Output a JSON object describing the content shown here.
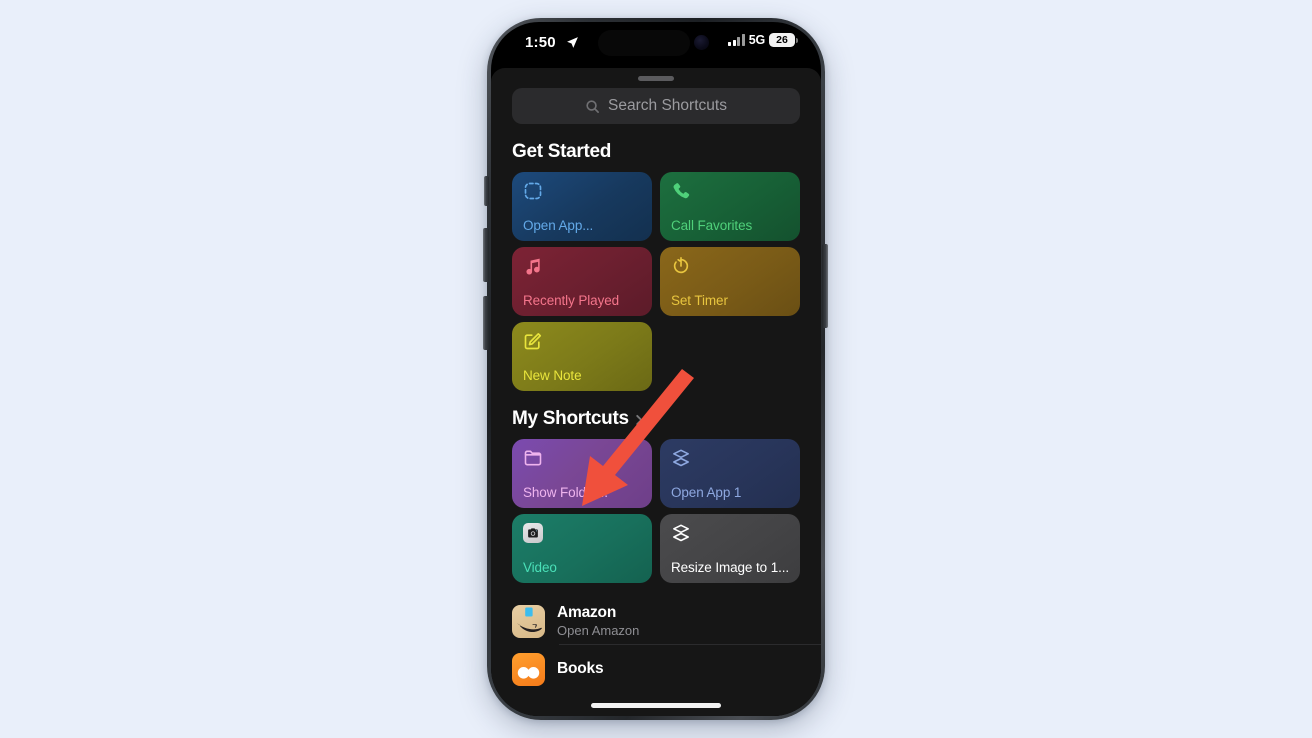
{
  "colors": {
    "page_background": "#e9effa",
    "screen_background": "#000000",
    "sheet_background": "#161616",
    "accent_arrow": "#f0503c",
    "search_field": "#2b2b2d"
  },
  "status_bar": {
    "time": "1:50",
    "location_icon": "location-arrow-icon",
    "cellular_icon": "cellular-bars-icon",
    "network": "5G",
    "battery_level": "26",
    "battery_icon": "battery-icon"
  },
  "sheet": {
    "grabber": "sheet-grabber"
  },
  "search": {
    "icon": "search-icon",
    "placeholder": "Search Shortcuts",
    "value": ""
  },
  "sections": [
    {
      "title": "Get Started",
      "has_chevron": false,
      "tiles": [
        {
          "label": "Open App...",
          "icon": "dashed-square-icon",
          "theme": "t-blue",
          "text_color": "#63a9e8",
          "icon_color": "#63a9e8"
        },
        {
          "label": "Call Favorites",
          "icon": "phone-icon",
          "theme": "t-green",
          "text_color": "#4fd07a",
          "icon_color": "#4fd07a"
        },
        {
          "label": "Recently Played",
          "icon": "music-note-icon",
          "theme": "t-red",
          "text_color": "#f4758b",
          "icon_color": "#f4758b"
        },
        {
          "label": "Set Timer",
          "icon": "timer-icon",
          "theme": "t-orange",
          "text_color": "#e8c53f",
          "icon_color": "#e8c53f"
        },
        {
          "label": "New Note",
          "icon": "compose-note-icon",
          "theme": "t-yellow",
          "text_color": "#e9e53c",
          "icon_color": "#e9e53c"
        }
      ]
    },
    {
      "title": "My Shortcuts",
      "has_chevron": true,
      "chevron_icon": "chevron-right-icon",
      "tiles": [
        {
          "label": "Show Folder...",
          "icon": "folder-icon",
          "theme": "t-purple",
          "text_color": "#efb4ee",
          "icon_color": "#efb4ee"
        },
        {
          "label": "Open App 1",
          "icon": "layers-icon",
          "theme": "t-navy",
          "text_color": "#8ea8e0",
          "icon_color": "#8ea8e0"
        },
        {
          "label": "Video",
          "icon": "camera-app-icon",
          "theme": "t-teal",
          "text_color": "#4ae0b8",
          "icon_color": "#ffffff"
        },
        {
          "label": "Resize Image to 1...",
          "icon": "layers-icon",
          "theme": "t-gray",
          "text_color": "#ffffff",
          "icon_color": "#ffffff"
        }
      ]
    }
  ],
  "shortcut_list": [
    {
      "title": "Amazon",
      "subtitle": "Open Amazon",
      "icon": "amazon-app-icon"
    },
    {
      "title": "Books",
      "subtitle": "",
      "icon": "books-app-icon"
    }
  ],
  "home_indicator": "home-indicator",
  "annotation": {
    "type": "arrow",
    "color": "#f0503c",
    "points_to": "Show Folder..."
  }
}
